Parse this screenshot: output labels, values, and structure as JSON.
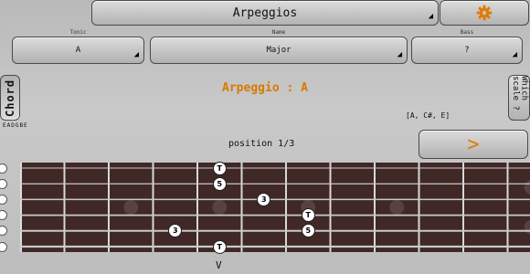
{
  "header": {
    "title": "Arpeggios",
    "settings_icon": "gear-icon"
  },
  "selectors": {
    "tonic_label": "Tonic",
    "tonic_value": "A",
    "name_label": "Name",
    "name_value": "Major",
    "bass_label": "Bass",
    "bass_value": "?"
  },
  "left": {
    "chord_label": "Chord",
    "tuning": "EADGBE"
  },
  "main": {
    "arpeggio_title": "Arpeggio : A",
    "notes": "[A, C#, E]",
    "position": "position 1/3",
    "which_scale_label": "Which scale ?",
    "next_label": ">"
  },
  "fretboard": {
    "strings": 6,
    "frets": 12,
    "inlay_frets": [
      3,
      5,
      7,
      9
    ],
    "double_inlay_fret": 12,
    "notes": [
      {
        "label": "T",
        "string": 1,
        "fret": 5
      },
      {
        "label": "5",
        "string": 2,
        "fret": 5
      },
      {
        "label": "3",
        "string": 3,
        "fret": 6
      },
      {
        "label": "T",
        "string": 4,
        "fret": 7
      },
      {
        "label": "3",
        "string": 5,
        "fret": 4
      },
      {
        "label": "5",
        "string": 5,
        "fret": 7
      },
      {
        "label": "T",
        "string": 6,
        "fret": 5
      }
    ],
    "marker": "V",
    "colors": {
      "wood": "#4a2f2d",
      "string": "#c9c9c9",
      "fret": "#d8d8d8",
      "accent": "#e07a00"
    }
  }
}
